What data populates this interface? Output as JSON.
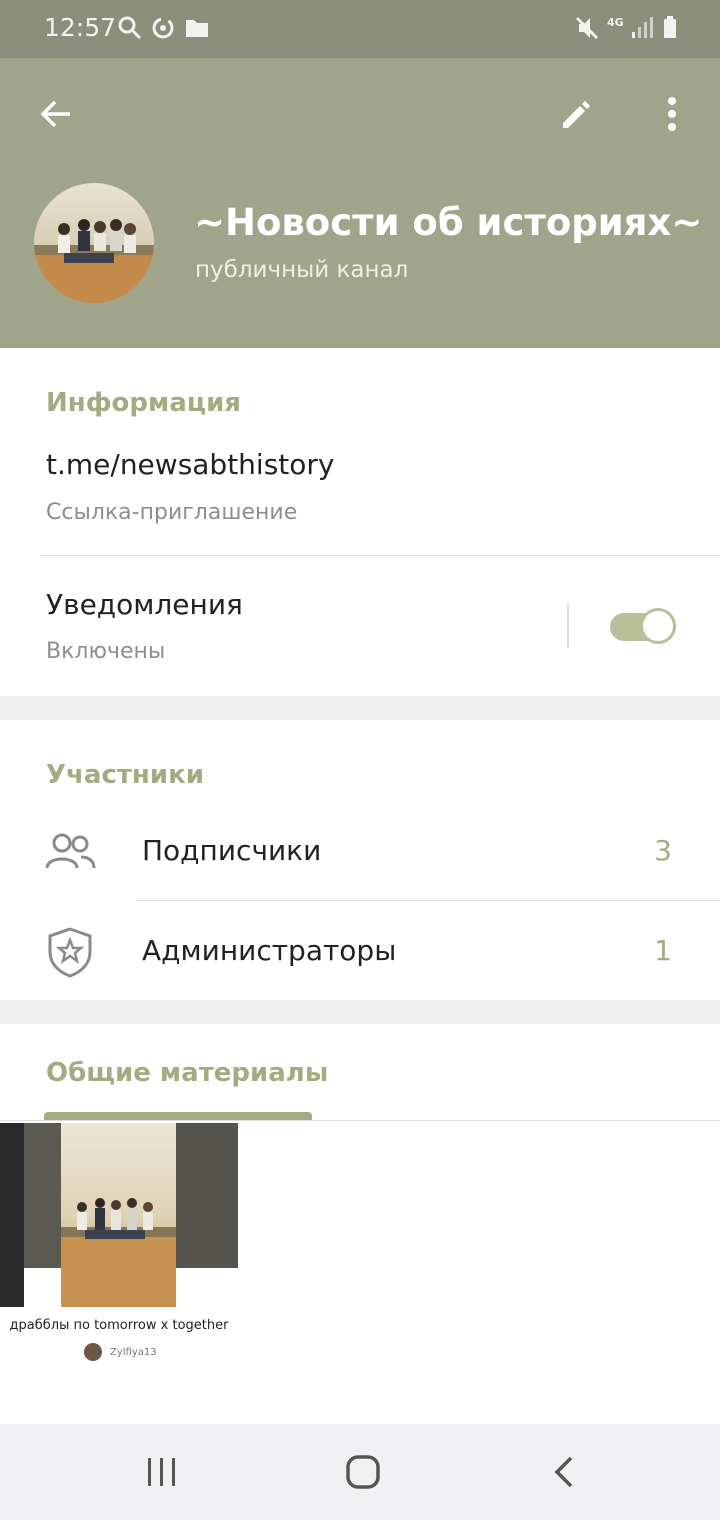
{
  "status_bar": {
    "time": "12:57",
    "network": "4G",
    "icons": [
      "search-icon",
      "sync-icon",
      "folder-icon",
      "mute-icon",
      "signal-icon",
      "battery-icon"
    ]
  },
  "header": {
    "title": "~Новости об историях~",
    "subtitle": "публичный канал",
    "icons": [
      "back-arrow-icon",
      "edit-pencil-icon",
      "more-vert-icon"
    ]
  },
  "info": {
    "section_title": "Информация",
    "link": "t.me/newsabthistory",
    "link_caption": "Ссылка-приглашение",
    "notifications_label": "Уведомления",
    "notifications_status": "Включены",
    "notifications_on": true
  },
  "members": {
    "section_title": "Участники",
    "items": [
      {
        "label": "Подписчики",
        "count": "3",
        "icon": "people-icon"
      },
      {
        "label": "Администраторы",
        "count": "1",
        "icon": "shield-star-icon"
      }
    ]
  },
  "shared": {
    "section_title": "Общие материалы",
    "item": {
      "caption": "драбблы по tomorrow x together",
      "author": "Zylfiya13"
    }
  },
  "colors": {
    "header_bg": "#9fa48b",
    "status_bg": "#8a8e7a",
    "accent": "#a4ab82"
  }
}
